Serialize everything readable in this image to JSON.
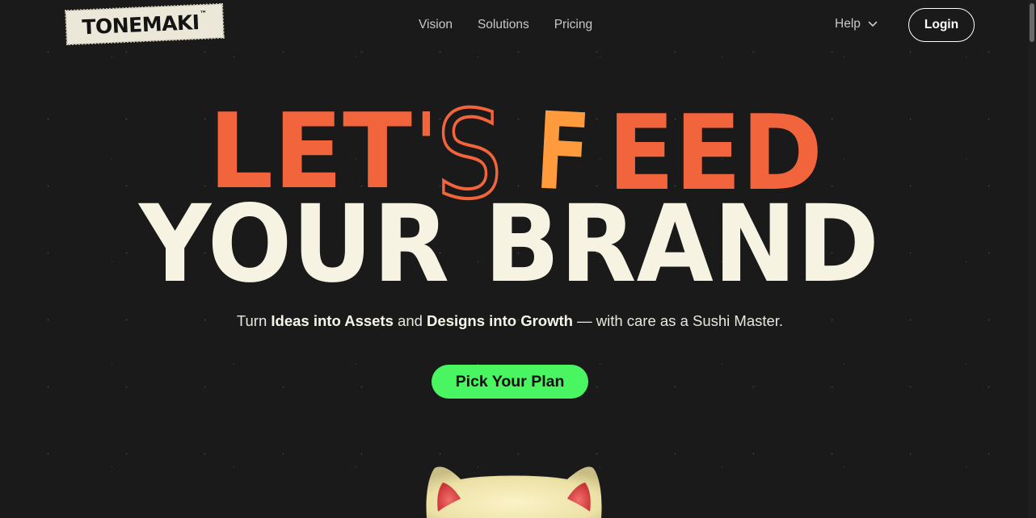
{
  "brand": {
    "logo_text": "TONEMAKI",
    "logo_tm": "™"
  },
  "nav": {
    "links": [
      "Vision",
      "Solutions",
      "Pricing"
    ],
    "help_label": "Help",
    "login_label": "Login"
  },
  "hero": {
    "line1": {
      "let": "LET",
      "apos": "'",
      "s": "S",
      "f": "F",
      "eed": "EED"
    },
    "line2": "YOUR BRAND",
    "tagline": {
      "p1": "Turn ",
      "b1": "Ideas into Assets",
      "p2": " and ",
      "b2": "Designs into Growth",
      "p3": " — with care as a Sushi Master."
    },
    "cta_label": "Pick Your Plan"
  },
  "colors": {
    "background": "#1a1a1a",
    "accent_coral": "#f2643c",
    "accent_orange": "#ff9a3d",
    "cream": "#f6f3e2",
    "cta_green": "#4af562"
  },
  "icons": {
    "help_chevron": "chevron-down-icon",
    "mascot": "lucky-cat-illustration"
  }
}
